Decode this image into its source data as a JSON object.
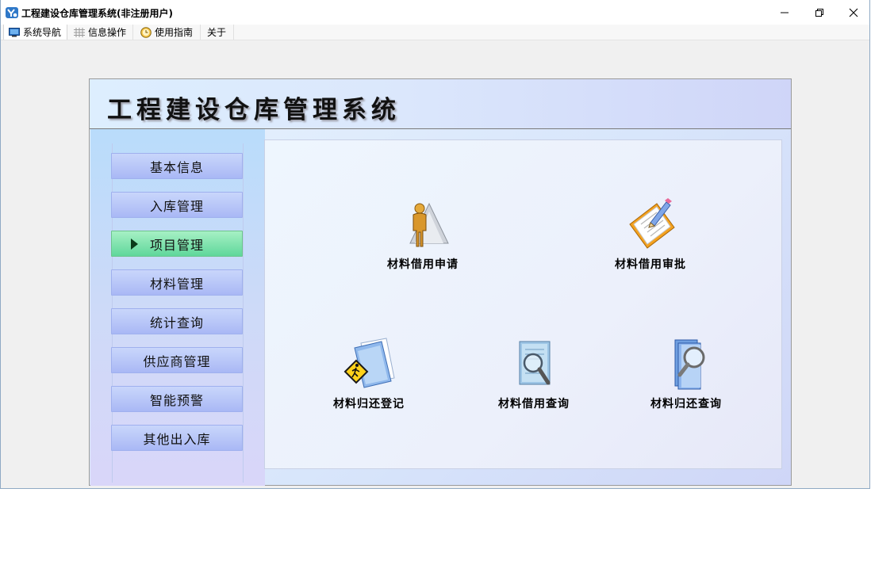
{
  "window": {
    "title": "工程建设仓库管理系统(非注册用户)"
  },
  "menubar": {
    "items": [
      {
        "label": "系统导航",
        "icon": "monitor-icon"
      },
      {
        "label": "信息操作",
        "icon": "grid-icon"
      },
      {
        "label": "使用指南",
        "icon": "clock-icon"
      },
      {
        "label": "关于"
      }
    ]
  },
  "banner": {
    "title": "工程建设仓库管理系统"
  },
  "sidebar": {
    "items": [
      {
        "label": "基本信息"
      },
      {
        "label": "入库管理"
      },
      {
        "label": "项目管理"
      },
      {
        "label": "材料管理"
      },
      {
        "label": "统计查询"
      },
      {
        "label": "供应商管理"
      },
      {
        "label": "智能预警"
      },
      {
        "label": "其他出入库"
      }
    ],
    "active_index": 2
  },
  "functions": [
    {
      "label": "材料借用申请",
      "icon": "person-icon"
    },
    {
      "label": "材料借用审批",
      "icon": "clipboard-pencil-icon"
    },
    {
      "label": "材料归还登记",
      "icon": "folder-pedestrian-icon"
    },
    {
      "label": "材料借用查询",
      "icon": "document-search-icon"
    },
    {
      "label": "材料归还查询",
      "icon": "book-search-icon"
    }
  ],
  "colors": {
    "nav_button": "#b2c0f7",
    "nav_active": "#73dca6",
    "banner_text": "#111111"
  }
}
